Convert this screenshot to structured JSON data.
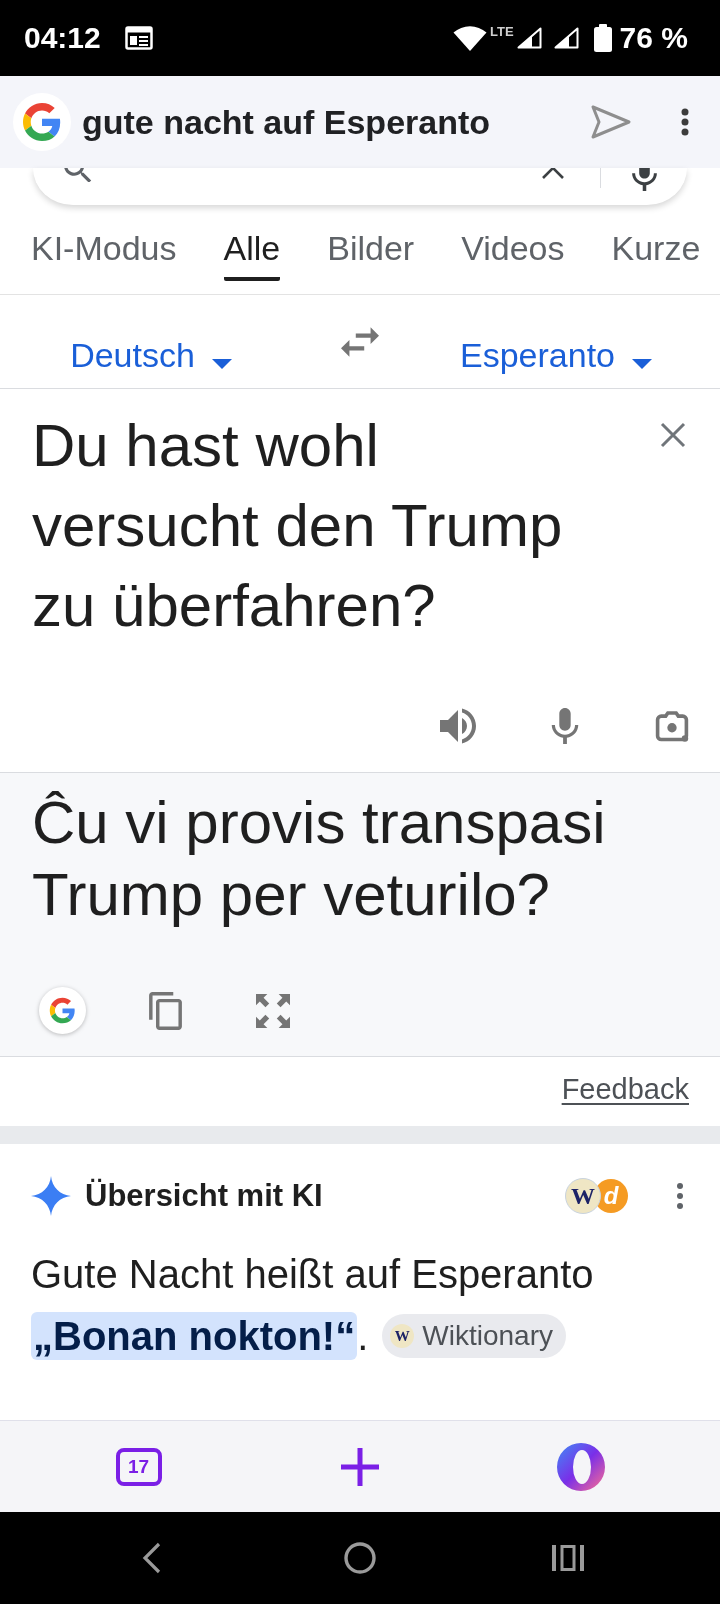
{
  "status_bar": {
    "time": "04:12",
    "network": "LTE",
    "battery": "76 %"
  },
  "address_bar": {
    "query": "gute nacht auf Esperanto"
  },
  "tabs": [
    {
      "label": "KI-Modus",
      "selected": false
    },
    {
      "label": "Alle",
      "selected": true
    },
    {
      "label": "Bilder",
      "selected": false
    },
    {
      "label": "Videos",
      "selected": false
    },
    {
      "label": "Kurze",
      "selected": false
    }
  ],
  "translator": {
    "source_language": "Deutsch",
    "target_language": "Esperanto",
    "source_text": "Du hast wohl versucht den Trump zu überfahren?",
    "translation": "Ĉu vi provis transpasi Trump per veturilo?",
    "feedback": "Feedback"
  },
  "ai_overview": {
    "title": "Übersicht mit KI",
    "sources": [
      {
        "glyph": "W",
        "color": "#efe6c4"
      },
      {
        "glyph": "d",
        "color": "#f59b23"
      }
    ],
    "answer": "Gute Nacht heißt auf Esperanto **„Bonan nokton!“**.",
    "source_chip": {
      "glyph": "W",
      "label": "Wiktionary"
    }
  },
  "bottom_toolbar": {
    "tab_count": "17"
  }
}
